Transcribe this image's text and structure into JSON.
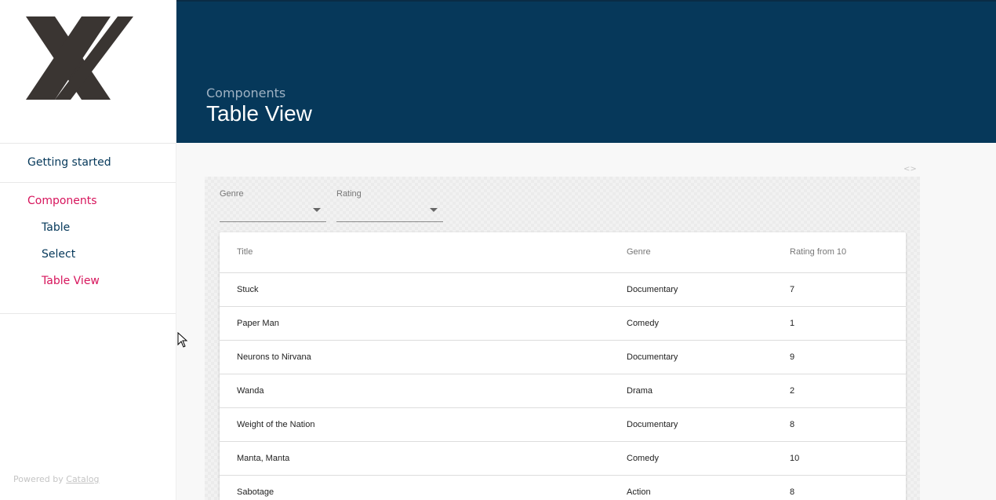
{
  "sidebar": {
    "getting_started": "Getting started",
    "components": "Components",
    "items": [
      {
        "label": "Table"
      },
      {
        "label": "Select"
      },
      {
        "label": "Table View"
      }
    ],
    "powered_prefix": "Powered by ",
    "powered_link": "Catalog"
  },
  "header": {
    "super": "Components",
    "title": "Table View",
    "bg_color": "#06385a"
  },
  "specimen": {
    "code_toggle": "<>",
    "filters": [
      {
        "label": "Genre",
        "value": ""
      },
      {
        "label": "Rating",
        "value": ""
      }
    ]
  },
  "table": {
    "headers": [
      "Title",
      "Genre",
      "Rating from 10"
    ],
    "rows": [
      [
        "Stuck",
        "Documentary",
        "7"
      ],
      [
        "Paper Man",
        "Comedy",
        "1"
      ],
      [
        "Neurons to Nirvana",
        "Documentary",
        "9"
      ],
      [
        "Wanda",
        "Drama",
        "2"
      ],
      [
        "Weight of the Nation",
        "Documentary",
        "8"
      ],
      [
        "Manta, Manta",
        "Comedy",
        "10"
      ],
      [
        "Sabotage",
        "Action",
        "8"
      ]
    ]
  },
  "colors": {
    "accent": "#d7155c",
    "nav_text": "#05385a"
  }
}
